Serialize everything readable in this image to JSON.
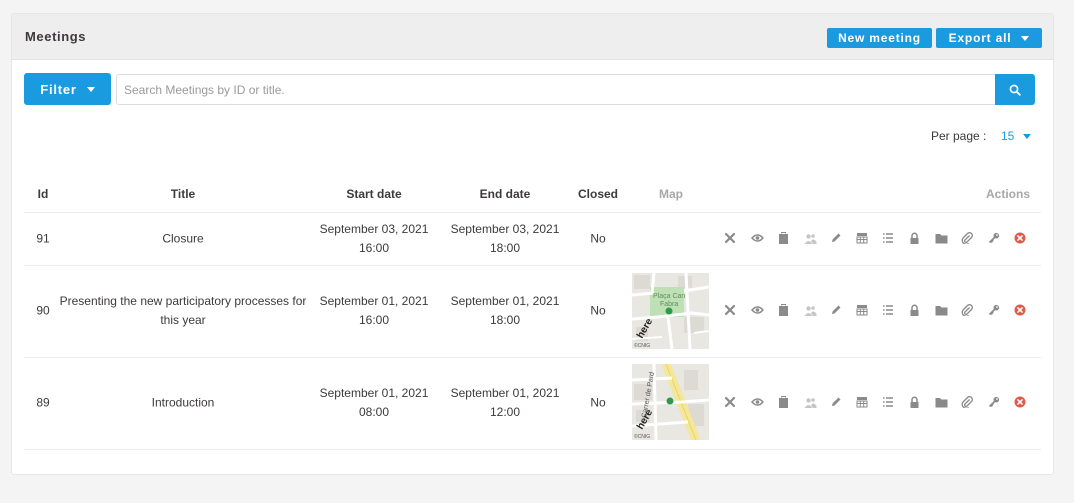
{
  "header": {
    "title": "Meetings",
    "new_meeting_label": "New meeting",
    "export_all_label": "Export all"
  },
  "filter": {
    "label": "Filter",
    "search_placeholder": "Search Meetings by ID or title."
  },
  "per_page": {
    "label": "Per page :",
    "value": "15"
  },
  "columns": {
    "id": "Id",
    "title": "Title",
    "start_date": "Start date",
    "end_date": "End date",
    "closed": "Closed",
    "map": "Map",
    "actions": "Actions"
  },
  "rows": [
    {
      "id": "91",
      "title": "Closure",
      "start_date": "September 03, 2021",
      "start_time": "16:00",
      "end_date": "September 03, 2021",
      "end_time": "18:00",
      "closed": "No"
    },
    {
      "id": "90",
      "title": "Presenting the new participatory processes for this year",
      "start_date": "September 01, 2021",
      "start_time": "16:00",
      "end_date": "September 01, 2021",
      "end_time": "18:00",
      "closed": "No",
      "map_labels": [
        "Plaça Can",
        "Fabra"
      ]
    },
    {
      "id": "89",
      "title": "Introduction",
      "start_date": "September 01, 2021",
      "start_time": "08:00",
      "end_date": "September 01, 2021",
      "end_time": "12:00",
      "closed": "No",
      "map_labels": [
        "Carrer de Pard"
      ]
    }
  ],
  "map_watermark": {
    "brand": "here",
    "credit": "©CNIG"
  },
  "action_icons": [
    "close-icon",
    "eye-icon",
    "clipboard-icon",
    "users-icon",
    "pencil-icon",
    "calendar-icon",
    "list-icon",
    "lock-icon",
    "folder-icon",
    "paperclip-icon",
    "key-icon",
    "delete-icon"
  ],
  "colors": {
    "primary": "#1a9be0",
    "danger": "#e0594a",
    "icon": "#8a8a8a"
  }
}
